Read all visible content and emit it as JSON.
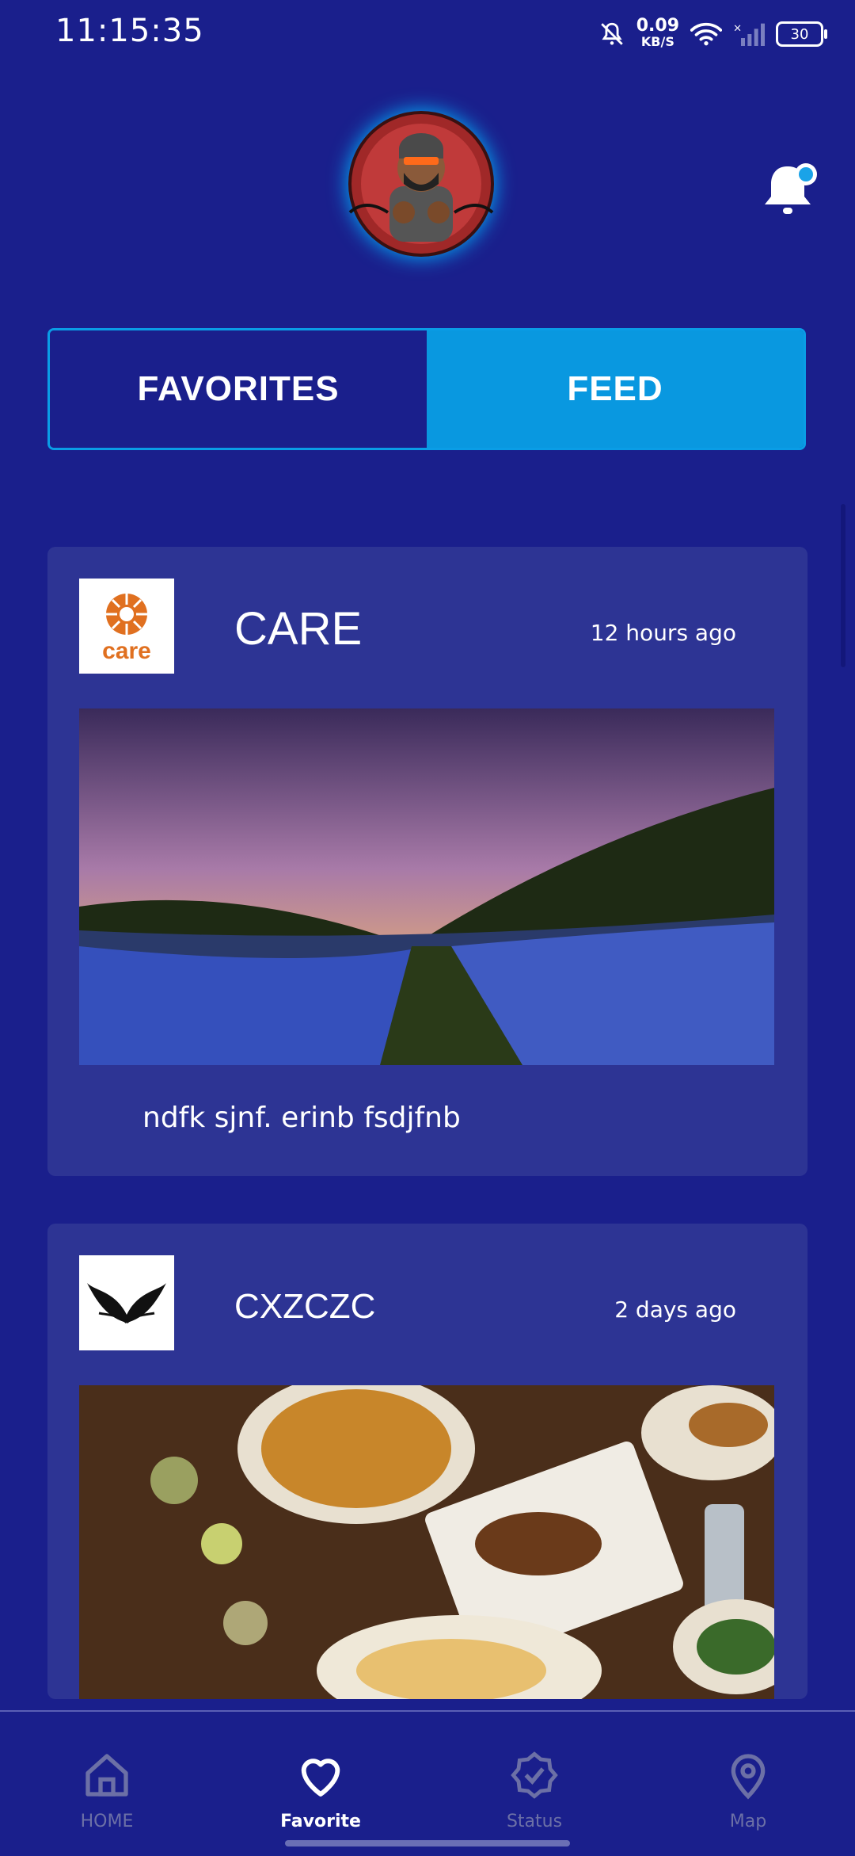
{
  "status_bar": {
    "time": "11:15:35",
    "net_speed_value": "0.09",
    "net_speed_unit": "KB/S",
    "battery": "30"
  },
  "tabs": [
    {
      "label": "FAVORITES",
      "active": false
    },
    {
      "label": "FEED",
      "active": true
    }
  ],
  "feed": [
    {
      "org": "CARE",
      "logo_text": "care",
      "time_ago": "12 hours ago",
      "caption": "ndfk sjnf. erinb fsdjfnb"
    },
    {
      "org": "CXZCZC",
      "time_ago": "2 days ago"
    }
  ],
  "bottom_nav": [
    {
      "label": "HOME",
      "icon": "home-icon",
      "active": false
    },
    {
      "label": "Favorite",
      "icon": "heart-icon",
      "active": true
    },
    {
      "label": "Status",
      "icon": "badge-check-icon",
      "active": false
    },
    {
      "label": "Map",
      "icon": "map-pin-icon",
      "active": false
    }
  ],
  "colors": {
    "background": "#1a1f8c",
    "card": "#2d3494",
    "accent": "#0998e0",
    "care_orange": "#e07020"
  }
}
